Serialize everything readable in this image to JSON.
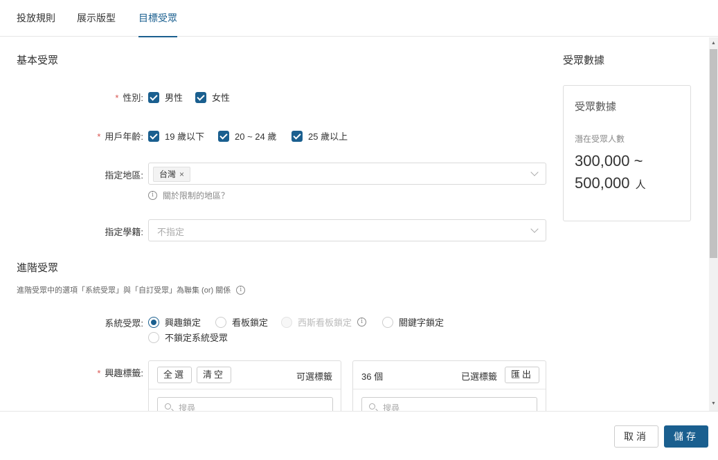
{
  "tabs": [
    {
      "label": "投放規則"
    },
    {
      "label": "展示版型"
    },
    {
      "label": "目標受眾",
      "active": true
    }
  ],
  "basic": {
    "title": "基本受眾",
    "gender": {
      "label": "性別:",
      "options": [
        "男性",
        "女性"
      ]
    },
    "age": {
      "label": "用戶年齡:",
      "options": [
        "19 歲以下",
        "20 ~ 24 歲",
        "25 歲以上"
      ]
    },
    "region": {
      "label": "指定地區:",
      "tag": "台灣",
      "tag_remove": "×",
      "hint": "關於限制的地區？"
    },
    "school": {
      "label": "指定學籍:",
      "placeholder": "不指定"
    }
  },
  "advanced": {
    "title": "進階受眾",
    "note": "進階受眾中的選項「系統受眾」與「自訂受眾」為聯集 (or) 關係",
    "system": {
      "label": "系統受眾:",
      "options": [
        {
          "label": "興趣鎖定",
          "checked": true
        },
        {
          "label": "看板鎖定"
        },
        {
          "label": "西斯看板鎖定",
          "disabled": true
        },
        {
          "label": "關鍵字鎖定"
        },
        {
          "label": "不鎖定系統受眾"
        }
      ]
    },
    "interest": {
      "label": "興趣標籤:",
      "left": {
        "select_all": "全選",
        "clear": "清空",
        "title": "可選標籤",
        "search_placeholder": "搜尋"
      },
      "right": {
        "count": "36 個",
        "title": "已選標籤",
        "export": "匯出",
        "search_placeholder": "搜尋"
      }
    }
  },
  "audience": {
    "header": "受眾數據",
    "card_title": "受眾數據",
    "potential_label": "潛在受眾人數",
    "range_line1": "300,000 ~",
    "range_line2": "500,000",
    "unit": "人"
  },
  "footer": {
    "cancel": "取消",
    "save": "儲存"
  },
  "colors": {
    "accent": "#1a5f8f",
    "required": "#d9534f"
  }
}
